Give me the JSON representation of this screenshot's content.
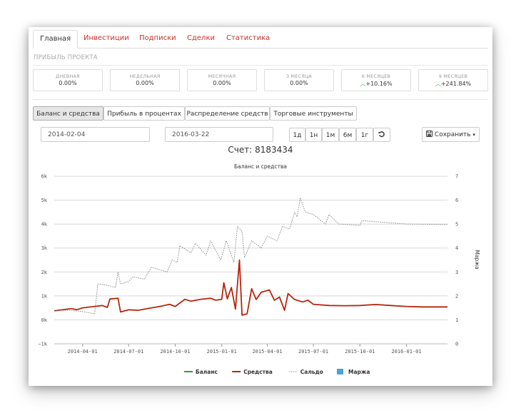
{
  "tabs": [
    {
      "label": "Главная",
      "active": true
    },
    {
      "label": "Инвестиции",
      "active": false
    },
    {
      "label": "Подписки",
      "active": false
    },
    {
      "label": "Сделки",
      "active": false
    },
    {
      "label": "Статистика",
      "active": false
    }
  ],
  "section_title": "ПРИБЫЛЬ ПРОЕКТА",
  "stats": [
    {
      "label": "ДНЕВНАЯ",
      "value": "0.00%"
    },
    {
      "label": "НЕДЕЛЬНАЯ",
      "value": "0.00%"
    },
    {
      "label": "МЕСЯЧНАЯ",
      "value": "0.00%"
    },
    {
      "label": "3 МЕСЯЦА",
      "value": "0.00%"
    },
    {
      "label": "6 МЕСЯЦЕВ",
      "value": "+10.16%",
      "trend": "up"
    },
    {
      "label": "9 МЕСЯЦЕВ",
      "value": "+241.84%",
      "trend": "up"
    }
  ],
  "chart_tabs": [
    {
      "label": "Баланс и средства",
      "active": true
    },
    {
      "label": "Прибыль в процентах",
      "active": false
    },
    {
      "label": "Распределение средств",
      "active": false
    },
    {
      "label": "Торговые инструменты",
      "active": false
    }
  ],
  "date_from": "2014-02-04",
  "date_to": "2016-03-22",
  "period_buttons": [
    "1д",
    "1н",
    "1м",
    "6м",
    "1г"
  ],
  "reset_icon": "refresh-icon",
  "save_label": "Сохранить",
  "account_label": "Счет: 8183434",
  "colors": {
    "balance": "#2ca02c",
    "equity": "#b5270e",
    "saldo": "#888888",
    "margin": "#4aa3df",
    "tab_link": "#c9302c",
    "up": "#3cb43c"
  },
  "chart_data": {
    "type": "line",
    "title": "Баланс и средства",
    "ylabel_right": "Маржа",
    "y_left_ticks": [
      "−1k",
      "0k",
      "1k",
      "2k",
      "3k",
      "4k",
      "5k",
      "6k"
    ],
    "y_left_range": [
      -1000,
      6000
    ],
    "y_right_ticks": [
      "0",
      "1",
      "2",
      "3",
      "4",
      "5",
      "6",
      "7"
    ],
    "y_right_range": [
      0,
      7
    ],
    "x_ticks": [
      "2014-04-01",
      "2014-07-01",
      "2014-10-01",
      "2015-01-01",
      "2015-04-01",
      "2015-07-01",
      "2015-10-01",
      "2016-01-01"
    ],
    "x_range": [
      "2014-02-04",
      "2016-03-22"
    ],
    "grid": true,
    "legend_position": "bottom",
    "series": [
      {
        "name": "Баланс",
        "style": "solid",
        "color": "#2ca02c",
        "points": []
      },
      {
        "name": "Средства",
        "style": "solid",
        "color": "#b5270e",
        "points": [
          [
            "2014-02-04",
            380
          ],
          [
            "2014-02-20",
            420
          ],
          [
            "2014-03-10",
            470
          ],
          [
            "2014-03-20",
            420
          ],
          [
            "2014-04-01",
            500
          ],
          [
            "2014-04-20",
            550
          ],
          [
            "2014-05-10",
            600
          ],
          [
            "2014-05-20",
            520
          ],
          [
            "2014-05-25",
            870
          ],
          [
            "2014-06-10",
            900
          ],
          [
            "2014-06-15",
            330
          ],
          [
            "2014-07-01",
            420
          ],
          [
            "2014-07-20",
            400
          ],
          [
            "2014-08-10",
            480
          ],
          [
            "2014-09-01",
            560
          ],
          [
            "2014-09-20",
            650
          ],
          [
            "2014-10-01",
            560
          ],
          [
            "2014-10-10",
            700
          ],
          [
            "2014-10-20",
            860
          ],
          [
            "2014-11-01",
            780
          ],
          [
            "2014-11-20",
            860
          ],
          [
            "2014-12-10",
            900
          ],
          [
            "2014-12-20",
            820
          ],
          [
            "2015-01-01",
            860
          ],
          [
            "2015-01-05",
            1550
          ],
          [
            "2015-01-12",
            880
          ],
          [
            "2015-01-20",
            1350
          ],
          [
            "2015-01-28",
            450
          ],
          [
            "2015-02-05",
            2500
          ],
          [
            "2015-02-10",
            200
          ],
          [
            "2015-02-20",
            250
          ],
          [
            "2015-03-01",
            1300
          ],
          [
            "2015-03-10",
            850
          ],
          [
            "2015-03-20",
            1150
          ],
          [
            "2015-04-05",
            1250
          ],
          [
            "2015-04-15",
            820
          ],
          [
            "2015-04-25",
            950
          ],
          [
            "2015-05-05",
            400
          ],
          [
            "2015-05-12",
            1100
          ],
          [
            "2015-05-25",
            850
          ],
          [
            "2015-06-10",
            750
          ],
          [
            "2015-06-20",
            820
          ],
          [
            "2015-07-01",
            650
          ],
          [
            "2015-08-01",
            600
          ],
          [
            "2015-09-01",
            590
          ],
          [
            "2015-10-01",
            600
          ],
          [
            "2015-11-01",
            640
          ],
          [
            "2015-12-01",
            600
          ],
          [
            "2016-01-01",
            560
          ],
          [
            "2016-02-01",
            540
          ],
          [
            "2016-03-22",
            540
          ]
        ]
      },
      {
        "name": "Сальдо",
        "style": "dotted",
        "color": "#888888",
        "points": [
          [
            "2014-02-04",
            400
          ],
          [
            "2014-03-01",
            400
          ],
          [
            "2014-04-01",
            350
          ],
          [
            "2014-04-25",
            250
          ],
          [
            "2014-05-01",
            1500
          ],
          [
            "2014-05-20",
            1450
          ],
          [
            "2014-06-05",
            1350
          ],
          [
            "2014-06-10",
            2000
          ],
          [
            "2014-06-15",
            1500
          ],
          [
            "2014-07-01",
            1600
          ],
          [
            "2014-07-10",
            1800
          ],
          [
            "2014-08-01",
            1700
          ],
          [
            "2014-08-15",
            2200
          ],
          [
            "2014-09-15",
            2000
          ],
          [
            "2014-09-25",
            2500
          ],
          [
            "2014-10-05",
            2400
          ],
          [
            "2014-10-10",
            3100
          ],
          [
            "2014-11-01",
            2800
          ],
          [
            "2014-11-10",
            3200
          ],
          [
            "2014-12-01",
            2700
          ],
          [
            "2014-12-10",
            3300
          ],
          [
            "2014-12-30",
            2500
          ],
          [
            "2015-01-10",
            3300
          ],
          [
            "2015-01-25",
            2400
          ],
          [
            "2015-02-01",
            3900
          ],
          [
            "2015-02-10",
            3700
          ],
          [
            "2015-02-15",
            2600
          ],
          [
            "2015-03-01",
            3300
          ],
          [
            "2015-03-20",
            3000
          ],
          [
            "2015-04-01",
            3500
          ],
          [
            "2015-04-20",
            3300
          ],
          [
            "2015-05-01",
            3900
          ],
          [
            "2015-05-15",
            3800
          ],
          [
            "2015-05-25",
            4500
          ],
          [
            "2015-05-30",
            4300
          ],
          [
            "2015-06-05",
            5100
          ],
          [
            "2015-06-15",
            4500
          ],
          [
            "2015-07-01",
            4400
          ],
          [
            "2015-07-25",
            4000
          ],
          [
            "2015-08-01",
            4400
          ],
          [
            "2015-08-20",
            4000
          ],
          [
            "2015-10-01",
            3950
          ],
          [
            "2015-10-05",
            4150
          ],
          [
            "2015-11-01",
            4100
          ],
          [
            "2015-12-01",
            4050
          ],
          [
            "2016-01-01",
            4000
          ],
          [
            "2016-03-22",
            3980
          ]
        ]
      },
      {
        "name": "Маржа",
        "style": "bar",
        "color": "#4aa3df",
        "points": []
      }
    ]
  }
}
